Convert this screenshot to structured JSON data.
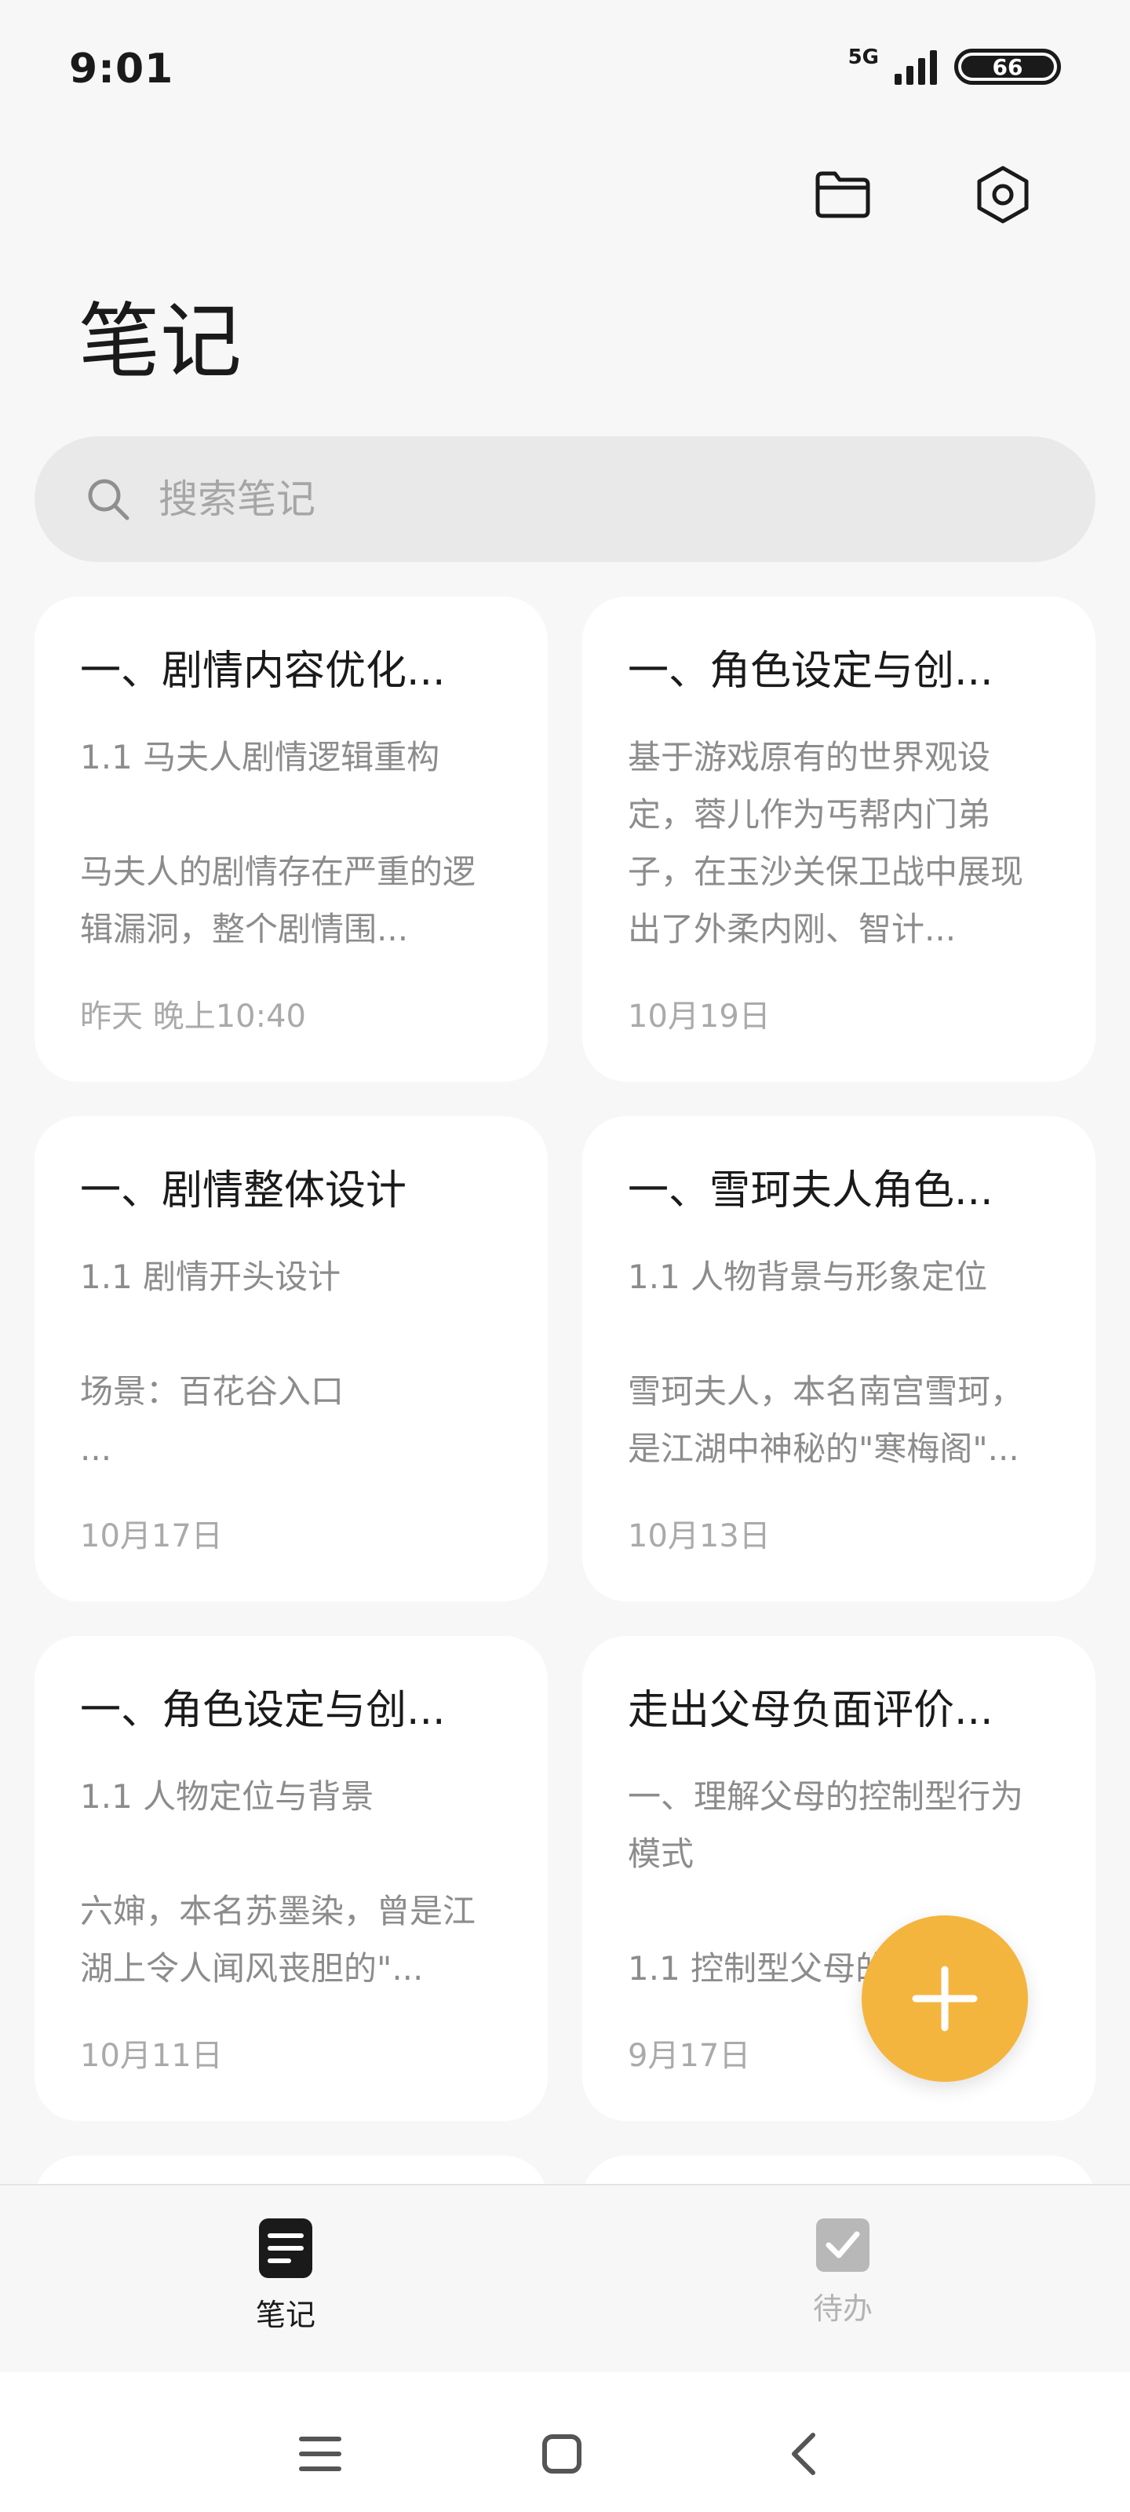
{
  "status_bar": {
    "time": "9:01",
    "network": "5G",
    "battery": "66"
  },
  "header": {
    "title": "笔记"
  },
  "search": {
    "placeholder": "搜索笔记"
  },
  "notes": [
    {
      "title": "一、剧情内容优化...",
      "body": "1.1 马夫人剧情逻辑重构\n\n马夫人的剧情存在严重的逻辑漏洞，整个剧情围...",
      "date": "昨天 晚上10:40"
    },
    {
      "title": "一、角色设定与创...",
      "body": "基于游戏原有的世界观设定，蓉儿作为丐帮内门弟子，在玉沙关保卫战中展现出了外柔内刚、智计...",
      "date": "10月19日"
    },
    {
      "title": "一、剧情整体设计",
      "body": "1.1 剧情开头设计\n\n场景：百花谷入口\n ...",
      "date": "10月17日"
    },
    {
      "title": "一、雪珂夫人角色...",
      "body": "1.1 人物背景与形象定位\n\n雪珂夫人，本名南宫雪珂，是江湖中神秘的\"寒梅阁\"...",
      "date": "10月13日"
    },
    {
      "title": "一、角色设定与创...",
      "body": "1.1 人物定位与背景\n\n六婶，本名苏墨染，曾是江湖上令人闻风丧胆的\"...",
      "date": "10月11日"
    },
    {
      "title": "走出父母负面评价...",
      "body": "一、理解父母的控制型行为模式\n\n1.1 控制型父母的",
      "date": "9月17日"
    }
  ],
  "tabs": [
    {
      "label": "笔记",
      "icon": "notes-icon",
      "active": true
    },
    {
      "label": "待办",
      "icon": "todo-checkbox-icon",
      "active": false
    }
  ],
  "colors": {
    "accent": "#f4b53f",
    "background": "#f7f7f7",
    "card": "#ffffff",
    "muted_text": "#8c8c8c"
  }
}
